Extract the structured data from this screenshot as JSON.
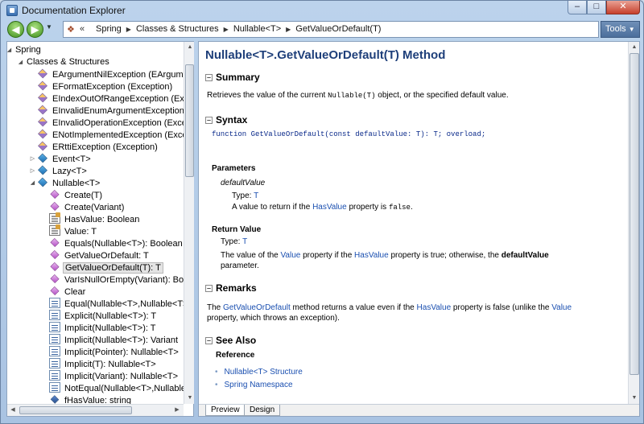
{
  "window": {
    "title": "Documentation Explorer",
    "controls": {
      "minimize": "–",
      "maximize": "□",
      "close": "✕"
    }
  },
  "toolbar": {
    "back_glyph": "◀",
    "forward_glyph": "▶",
    "address_chevron": "«",
    "breadcrumbs": [
      "Spring",
      "Classes & Structures",
      "Nullable<T>",
      "GetValueOrDefault(T)"
    ],
    "tools_label": "Tools"
  },
  "tree": {
    "nodes": [
      {
        "label": "Spring",
        "icon": "none",
        "expander": "expanded"
      },
      {
        "label": "Classes & Structures",
        "icon": "none",
        "expander": "expanded"
      },
      {
        "label": "EArgumentNilException (EArgumentException)",
        "icon": "class-icon"
      },
      {
        "label": "EFormatException (Exception)",
        "icon": "class-icon"
      },
      {
        "label": "EIndexOutOfRangeException (Exception)",
        "icon": "class-icon"
      },
      {
        "label": "EInvalidEnumArgumentException (Exception)",
        "icon": "class-icon"
      },
      {
        "label": "EInvalidOperationException (Exception)",
        "icon": "class-icon"
      },
      {
        "label": "ENotImplementedException (Exception)",
        "icon": "class-icon"
      },
      {
        "label": "ERttiException (Exception)",
        "icon": "class-icon"
      },
      {
        "label": "Event<T>",
        "icon": "struct-icon",
        "expander": "collapsed"
      },
      {
        "label": "Lazy<T>",
        "icon": "struct-icon",
        "expander": "collapsed"
      },
      {
        "label": "Nullable<T>",
        "icon": "struct-icon",
        "expander": "expanded"
      },
      {
        "label": "Create(T)",
        "icon": "method-icon"
      },
      {
        "label": "Create(Variant)",
        "icon": "method-icon"
      },
      {
        "label": "HasValue: Boolean",
        "icon": "property-icon"
      },
      {
        "label": "Value: T",
        "icon": "property-icon"
      },
      {
        "label": "Equals(Nullable<T>): Boolean",
        "icon": "method-icon"
      },
      {
        "label": "GetValueOrDefault: T",
        "icon": "method-icon"
      },
      {
        "label": "GetValueOrDefault(T): T",
        "icon": "method-icon",
        "selected": true
      },
      {
        "label": "VarIsNullOrEmpty(Variant): Boolean",
        "icon": "method-icon"
      },
      {
        "label": "Clear",
        "icon": "method-icon"
      },
      {
        "label": "Equal(Nullable<T>,Nullable<T>): Boolean",
        "icon": "operator-icon"
      },
      {
        "label": "Explicit(Nullable<T>): T",
        "icon": "operator-icon"
      },
      {
        "label": "Implicit(Nullable<T>): T",
        "icon": "operator-icon"
      },
      {
        "label": "Implicit(Nullable<T>): Variant",
        "icon": "operator-icon"
      },
      {
        "label": "Implicit(Pointer): Nullable<T>",
        "icon": "operator-icon"
      },
      {
        "label": "Implicit(T): Nullable<T>",
        "icon": "operator-icon"
      },
      {
        "label": "Implicit(Variant): Nullable<T>",
        "icon": "operator-icon"
      },
      {
        "label": "NotEqual(Nullable<T>,Nullable<T>): Boolean",
        "icon": "operator-icon"
      },
      {
        "label": "fHasValue: string",
        "icon": "field-icon"
      }
    ]
  },
  "doc": {
    "title": "Nullable<T>.GetValueOrDefault(T) Method",
    "collapse_glyph": "–",
    "summary": {
      "heading": "Summary",
      "text_before": "Retrieves the value of the current ",
      "code": "Nullable(T)",
      "text_after": " object, or the specified default value."
    },
    "syntax": {
      "heading": "Syntax",
      "code": "function GetValueOrDefault(const defaultValue: T): T; overload;",
      "parameters_heading": "Parameters",
      "param_name": "defaultValue",
      "param_type_label": "Type: ",
      "param_type": "T",
      "param_desc_before": "A value to return if the ",
      "param_desc_link": "HasValue",
      "param_desc_mid": " property is ",
      "param_desc_code": "false",
      "param_desc_after": ".",
      "return_heading": "Return Value",
      "return_type_label": "Type: ",
      "return_type": "T",
      "return_line1_a": "The value of the ",
      "return_line1_link1": "Value",
      "return_line1_b": " property if the ",
      "return_line1_link2": "HasValue",
      "return_line1_c": " property is true; otherwise, the ",
      "return_line1_bold": "defaultValue",
      "return_line2": "parameter."
    },
    "remarks": {
      "heading": "Remarks",
      "line1_a": "The ",
      "line1_link1": "GetValueOrDefault",
      "line1_b": " method returns a value even if the ",
      "line1_link2": "HasValue",
      "line1_c": " property is false (unlike the ",
      "line1_link3": "Value",
      "line2": "property, which throws an exception)."
    },
    "see_also": {
      "heading": "See Also",
      "reference_heading": "Reference",
      "links": [
        "Nullable<T> Structure",
        "Spring Namespace"
      ]
    }
  },
  "tabs": [
    "Preview",
    "Design"
  ],
  "scroll": {
    "tree_vertical_fraction": 0.05,
    "doc_vertical_fraction": 0.0
  }
}
